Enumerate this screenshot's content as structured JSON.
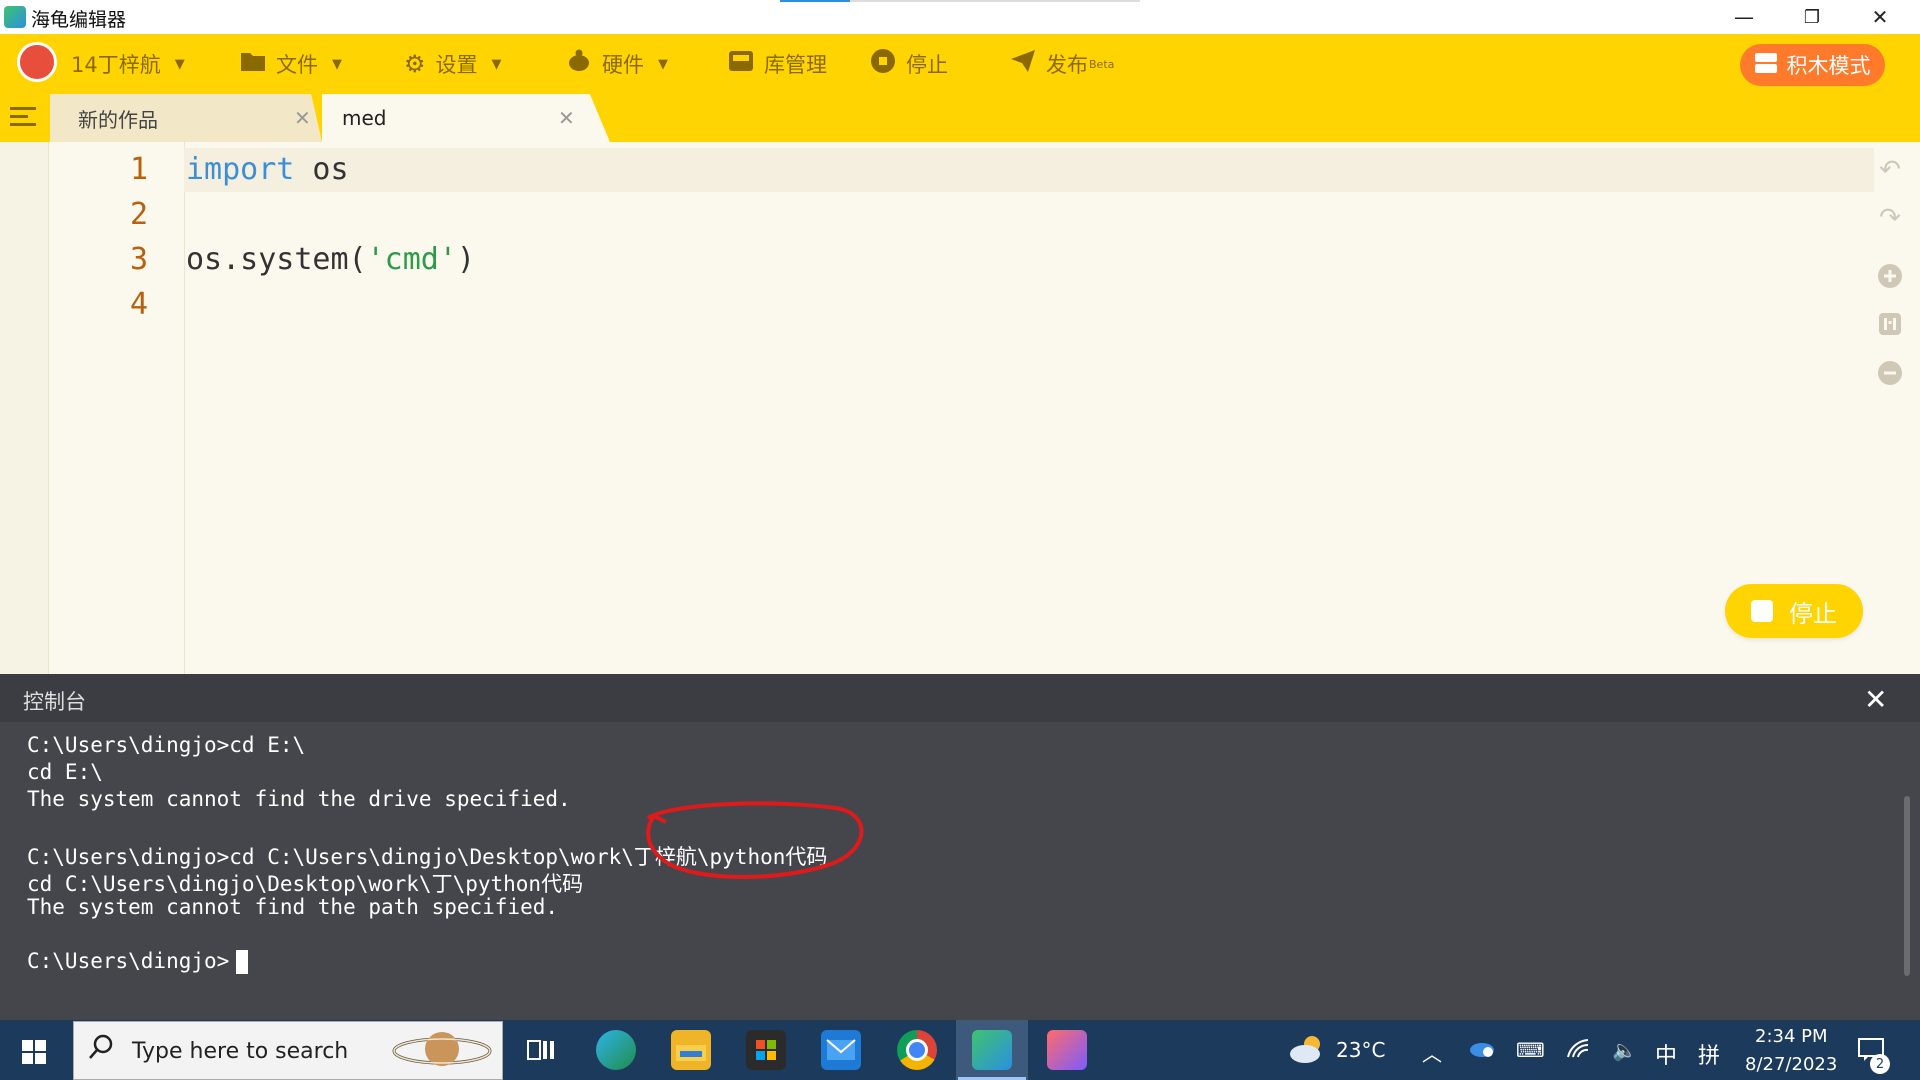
{
  "window": {
    "title": "海龟编辑器",
    "minimize_glyph": "—",
    "restore_glyph": "❐",
    "close_glyph": "✕"
  },
  "toolbar": {
    "user_label": "14丁梓航",
    "file_label": "文件",
    "settings_label": "设置",
    "hardware_label": "硬件",
    "library_label": "库管理",
    "stop_label": "停止",
    "publish_label": "发布",
    "publish_badge": "Beta",
    "block_mode_label": "积木模式"
  },
  "tabs": [
    {
      "label": "新的作品"
    },
    {
      "label": "med"
    }
  ],
  "editor": {
    "line_numbers": [
      "1",
      "2",
      "3",
      "4"
    ],
    "line1_kw": "import",
    "line1_rest": " os",
    "line3_prefix": "os.system(",
    "line3_str": "'cmd'",
    "line3_suffix": ")"
  },
  "floating_stop_label": "停止",
  "console": {
    "title": "控制台",
    "lines": [
      "C:\\Users\\dingjo>cd E:\\",
      "cd E:\\",
      "The system cannot find the drive specified.",
      "",
      "C:\\Users\\dingjo>cd C:\\Users\\dingjo\\Desktop\\work\\丁梓航\\python代码",
      "cd C:\\Users\\dingjo\\Desktop\\work\\丁\\python代码",
      "The system cannot find the path specified.",
      "",
      "C:\\Users\\dingjo>"
    ]
  },
  "taskbar": {
    "search_placeholder": "Type here to search",
    "weather": "23°C",
    "ime_lang": "中",
    "ime_mode": "拼",
    "time": "2:34 PM",
    "date": "8/27/2023",
    "notification_count": "2"
  },
  "colors": {
    "accent_yellow": "#ffd400",
    "block_mode_orange": "#ff7a2a",
    "keyword_blue": "#3b8fd9",
    "string_green": "#2f9a4a",
    "line_number_brown": "#b8600c",
    "console_bg": "#44464b",
    "annotation_red": "#e01a1a"
  }
}
